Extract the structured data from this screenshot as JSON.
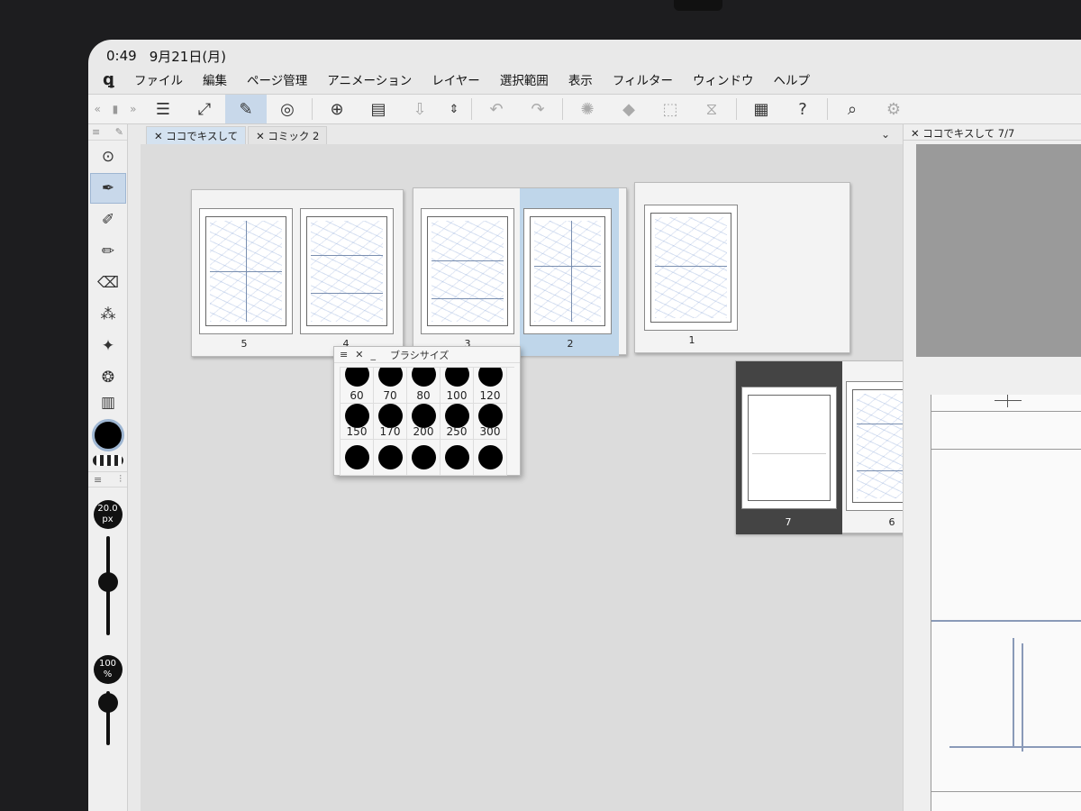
{
  "status": {
    "time": "0:49",
    "date": "9月21日(月)"
  },
  "menu": {
    "items": [
      "ファイル",
      "編集",
      "ページ管理",
      "アニメーション",
      "レイヤー",
      "選択範囲",
      "表示",
      "フィルター",
      "ウィンドウ",
      "ヘルプ"
    ]
  },
  "tabs": [
    {
      "label": "ココでキスして"
    },
    {
      "label": "コミック 2"
    }
  ],
  "right_panel": {
    "title": "ココでキスして 7/7"
  },
  "pages": {
    "p1": "1",
    "p2": "2",
    "p3": "3",
    "p4": "4",
    "p5": "5",
    "p6": "6",
    "p7": "7"
  },
  "brush_popup": {
    "title": "ブラシサイズ",
    "sizes": [
      "60",
      "70",
      "80",
      "100",
      "120",
      "150",
      "170",
      "200",
      "250",
      "300",
      "",
      "",
      "",
      "",
      ""
    ]
  },
  "tool_property": {
    "brush_size": "20.0",
    "brush_size_unit": "px",
    "opacity": "100",
    "opacity_unit": "%"
  },
  "colors": {
    "accent_selected": "#c8d8ea",
    "main_color": "#000000"
  },
  "icons": {
    "toolbar": [
      "menu-icon",
      "fit-icon",
      "edit-icon",
      "clip-icon",
      "new-page-icon",
      "open-folder-icon",
      "save-icon",
      "undo-icon",
      "redo-icon",
      "loading-icon",
      "fill-icon",
      "transform-icon",
      "flip-icon",
      "device-icon",
      "help-icon",
      "search-icon",
      "settings-icon"
    ]
  }
}
